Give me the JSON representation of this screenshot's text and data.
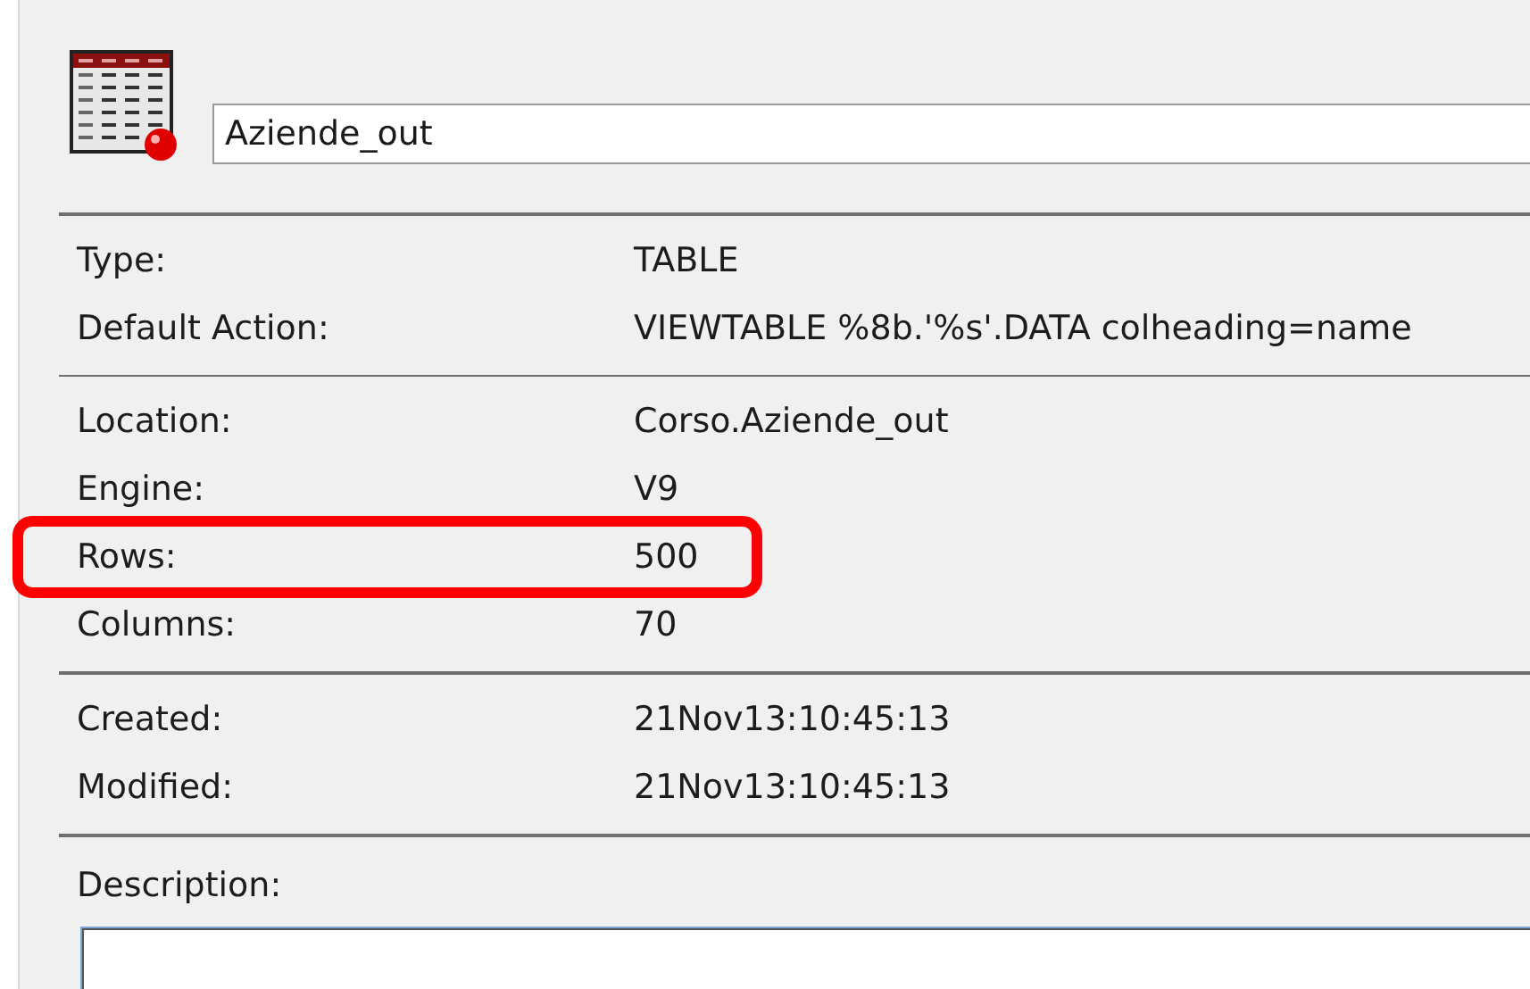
{
  "name_field": {
    "value": "Aziende_out"
  },
  "sections": [
    {
      "rows": [
        {
          "label": "Type:",
          "value": "TABLE",
          "highlighted": false
        },
        {
          "label": "Default Action:",
          "value": "VIEWTABLE %8b.'%s'.DATA colheading=name",
          "highlighted": false
        }
      ]
    },
    {
      "rows": [
        {
          "label": "Location:",
          "value": "Corso.Aziende_out",
          "highlighted": false
        },
        {
          "label": "Engine:",
          "value": "V9",
          "highlighted": false
        },
        {
          "label": "Rows:",
          "value": "500",
          "highlighted": true
        },
        {
          "label": "Columns:",
          "value": "70",
          "highlighted": false
        }
      ]
    },
    {
      "rows": [
        {
          "label": "Created:",
          "value": "21Nov13:10:45:13",
          "highlighted": false
        },
        {
          "label": "Modified:",
          "value": "21Nov13:10:45:13",
          "highlighted": false
        }
      ]
    }
  ],
  "description": {
    "label": "Description:"
  }
}
